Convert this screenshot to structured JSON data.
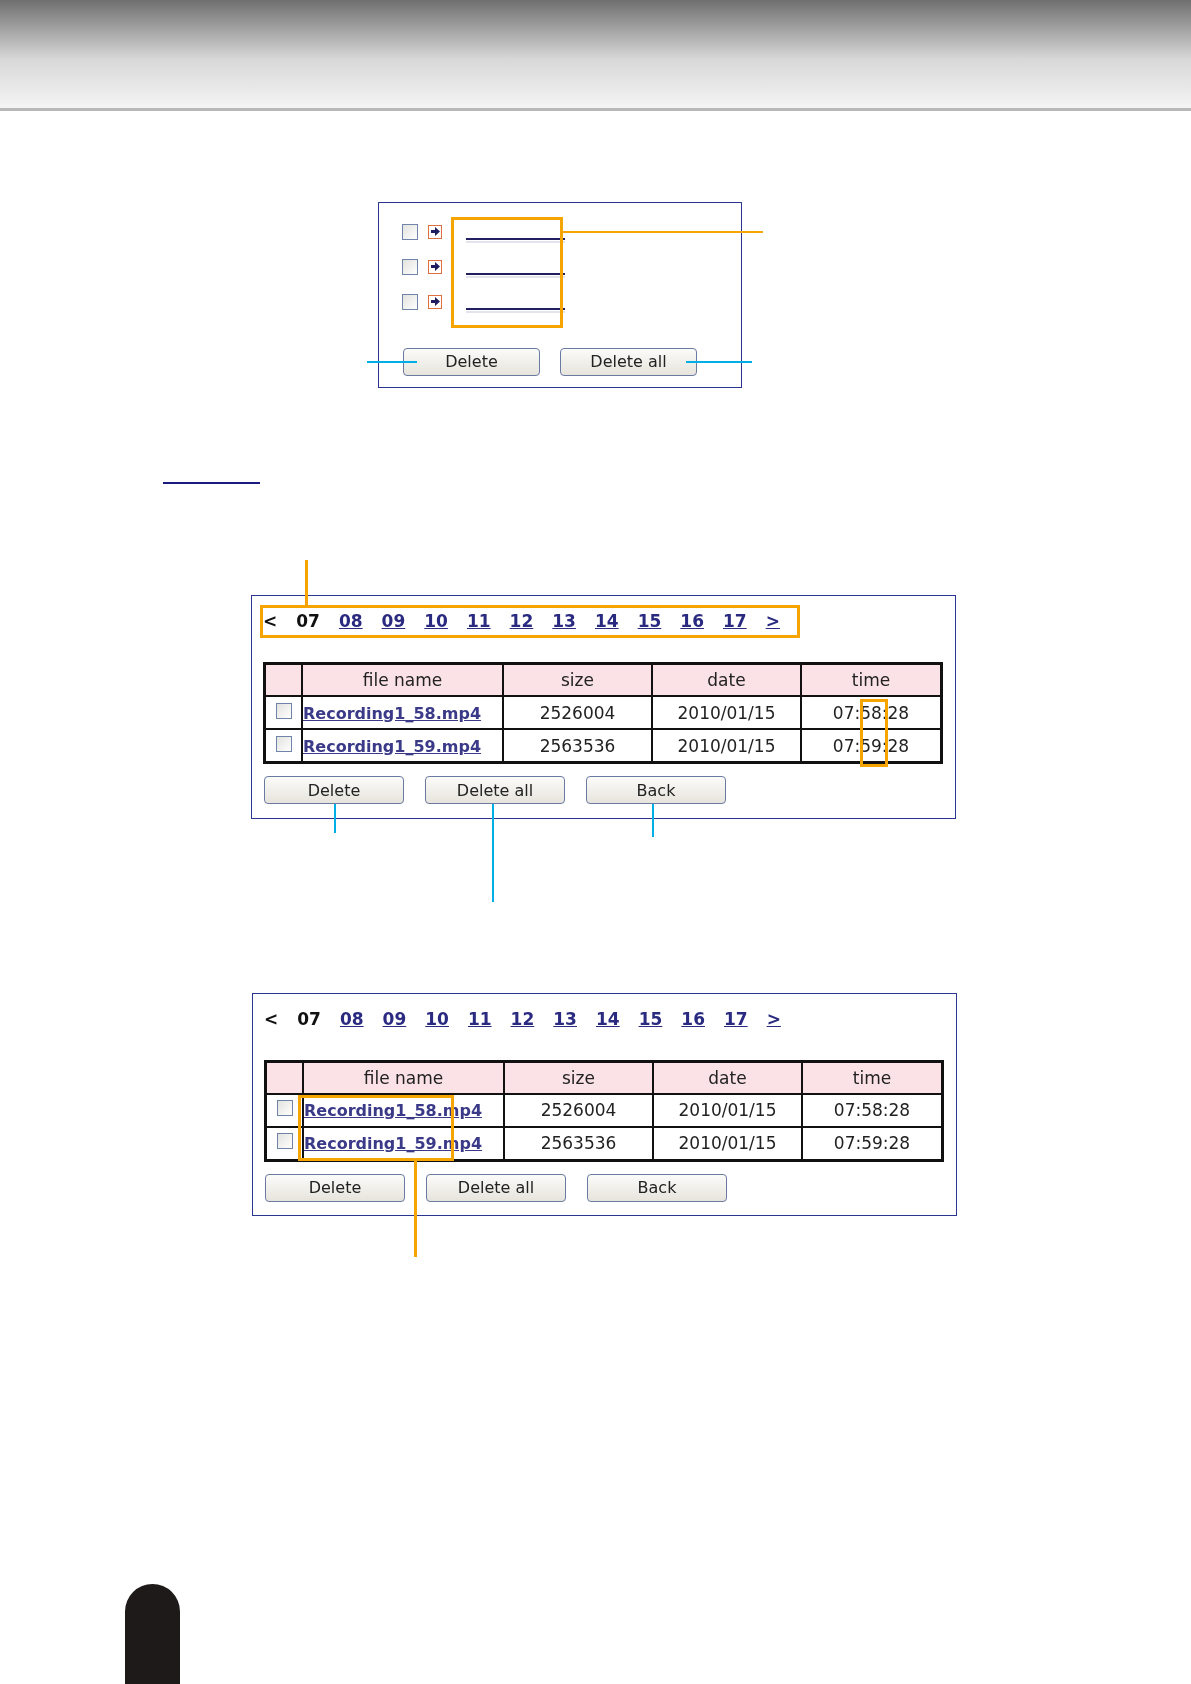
{
  "panels": [
    {
      "kind": "event-list",
      "rows": [
        {
          "checked": false
        },
        {
          "checked": false
        },
        {
          "checked": false
        }
      ],
      "buttons": [
        "Delete",
        "Delete all"
      ]
    },
    {
      "kind": "file-list",
      "pager": {
        "prev": "<",
        "next": ">",
        "pages": [
          {
            "label": "07",
            "selected": true
          },
          {
            "label": "08",
            "selected": false
          },
          {
            "label": "09",
            "selected": false
          },
          {
            "label": "10",
            "selected": false
          },
          {
            "label": "11",
            "selected": false
          },
          {
            "label": "12",
            "selected": false
          },
          {
            "label": "13",
            "selected": false
          },
          {
            "label": "14",
            "selected": false
          },
          {
            "label": "15",
            "selected": false
          },
          {
            "label": "16",
            "selected": false
          },
          {
            "label": "17",
            "selected": false
          }
        ]
      },
      "columns": [
        "file name",
        "size",
        "date",
        "time"
      ],
      "rows": [
        {
          "checked": false,
          "cells": [
            "Recording1_58.mp4",
            "2526004",
            "2010/01/15",
            "07:58:28"
          ]
        },
        {
          "checked": false,
          "cells": [
            "Recording1_59.mp4",
            "2563536",
            "2010/01/15",
            "07:59:28"
          ]
        }
      ],
      "buttons": [
        "Delete",
        "Delete all",
        "Back"
      ]
    },
    {
      "kind": "file-list",
      "pager": {
        "prev": "<",
        "next": ">",
        "pages": [
          {
            "label": "07",
            "selected": true
          },
          {
            "label": "08",
            "selected": false
          },
          {
            "label": "09",
            "selected": false
          },
          {
            "label": "10",
            "selected": false
          },
          {
            "label": "11",
            "selected": false
          },
          {
            "label": "12",
            "selected": false
          },
          {
            "label": "13",
            "selected": false
          },
          {
            "label": "14",
            "selected": false
          },
          {
            "label": "15",
            "selected": false
          },
          {
            "label": "16",
            "selected": false
          },
          {
            "label": "17",
            "selected": false
          }
        ]
      },
      "columns": [
        "file name",
        "size",
        "date",
        "time"
      ],
      "rows": [
        {
          "checked": false,
          "cells": [
            "Recording1_58.mp4",
            "2526004",
            "2010/01/15",
            "07:58:28"
          ]
        },
        {
          "checked": false,
          "cells": [
            "Recording1_59.mp4",
            "2563536",
            "2010/01/15",
            "07:59:28"
          ]
        }
      ],
      "buttons": [
        "Delete",
        "Delete all",
        "Back"
      ]
    }
  ]
}
